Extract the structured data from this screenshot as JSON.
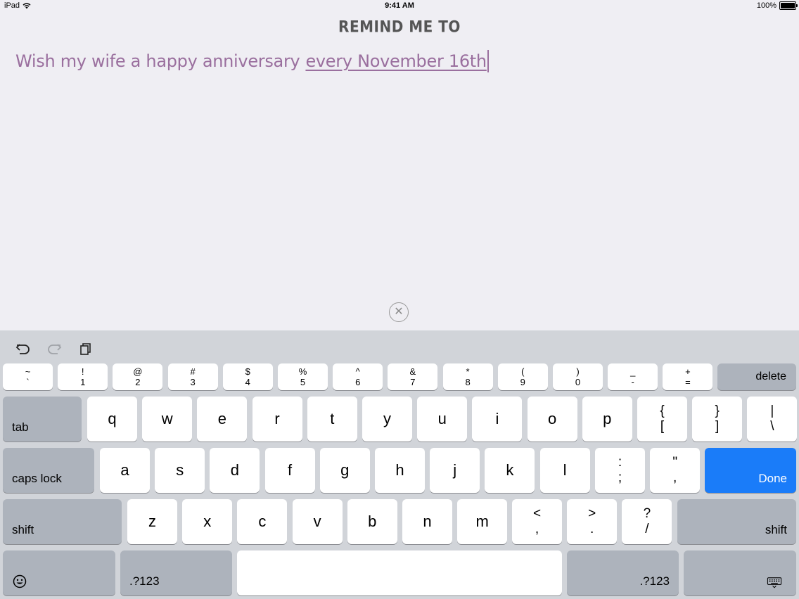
{
  "status": {
    "device": "iPad",
    "time": "9:41 AM",
    "battery": "100%",
    "battery_level": 1.0
  },
  "header": {
    "title": "REMIND ME TO"
  },
  "reminder": {
    "text_plain": "Wish my wife a happy anniversary",
    "text_highlight": "every November 16th"
  },
  "icons": {
    "wifi": "wifi-icon",
    "battery": "battery-icon",
    "clear": "clear-icon",
    "undo": "undo-icon",
    "redo": "redo-icon",
    "paste": "paste-icon",
    "emoji": "emoji-icon",
    "keyboard_dismiss": "keyboard-dismiss-icon"
  },
  "keyboard": {
    "number_row": [
      {
        "top": "~",
        "bottom": "`"
      },
      {
        "top": "!",
        "bottom": "1"
      },
      {
        "top": "@",
        "bottom": "2"
      },
      {
        "top": "#",
        "bottom": "3"
      },
      {
        "top": "$",
        "bottom": "4"
      },
      {
        "top": "%",
        "bottom": "5"
      },
      {
        "top": "^",
        "bottom": "6"
      },
      {
        "top": "&",
        "bottom": "7"
      },
      {
        "top": "*",
        "bottom": "8"
      },
      {
        "top": "(",
        "bottom": "9"
      },
      {
        "top": ")",
        "bottom": "0"
      },
      {
        "top": "_",
        "bottom": "-"
      },
      {
        "top": "+",
        "bottom": "="
      }
    ],
    "delete": "delete",
    "tab": "tab",
    "row1": [
      "q",
      "w",
      "e",
      "r",
      "t",
      "y",
      "u",
      "i",
      "o",
      "p"
    ],
    "row1_extra": [
      {
        "top": "{",
        "bottom": "["
      },
      {
        "top": "}",
        "bottom": "]"
      },
      {
        "top": "|",
        "bottom": "\\"
      }
    ],
    "caps_lock": "caps lock",
    "row2": [
      "a",
      "s",
      "d",
      "f",
      "g",
      "h",
      "j",
      "k",
      "l"
    ],
    "row2_extra": [
      {
        "top": ":",
        "bottom": ";"
      },
      {
        "top": "\"",
        "bottom": ","
      }
    ],
    "done": "Done",
    "shift": "shift",
    "row3": [
      "z",
      "x",
      "c",
      "v",
      "b",
      "n",
      "m"
    ],
    "row3_extra": [
      {
        "top": "<",
        "bottom": ","
      },
      {
        "top": ">",
        "bottom": "."
      },
      {
        "top": "?",
        "bottom": "/"
      }
    ],
    "numbers_toggle": ".?123",
    "colors": {
      "done_key": "#1a7cf9",
      "reminder_text": "#9a6f9e"
    }
  }
}
